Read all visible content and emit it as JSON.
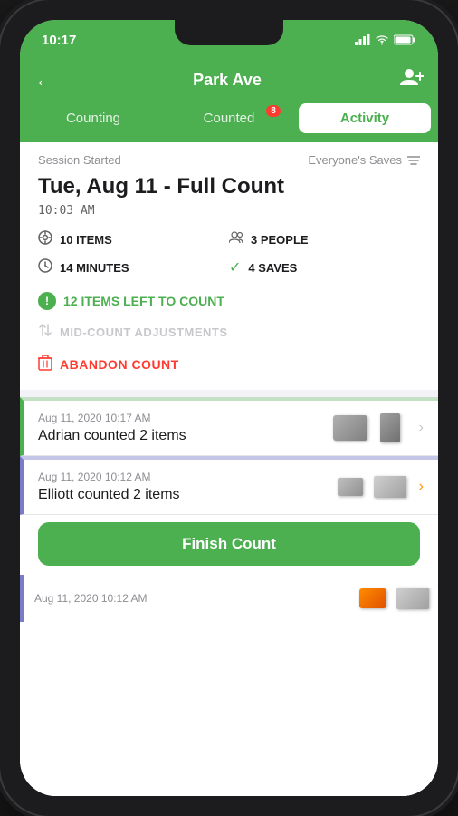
{
  "device": {
    "time": "10:17"
  },
  "header": {
    "back_label": "←",
    "title": "Park Ave",
    "add_user_icon": "👥"
  },
  "tabs": [
    {
      "id": "counting",
      "label": "Counting",
      "active": false,
      "badge": null
    },
    {
      "id": "counted",
      "label": "Counted",
      "active": false,
      "badge": "8"
    },
    {
      "id": "activity",
      "label": "Activity",
      "active": true,
      "badge": null
    }
  ],
  "session": {
    "started_label": "Session Started",
    "filter_label": "Everyone's Saves",
    "filter_icon": "funnel"
  },
  "count_card": {
    "title": "Tue, Aug 11 - Full Count",
    "time": "10:03 AM",
    "stats": [
      {
        "icon": "clock",
        "value": "10 ITEMS",
        "icon_type": "settings"
      },
      {
        "icon": "people",
        "value": "3 PEOPLE",
        "icon_type": "people"
      },
      {
        "icon": "clock",
        "value": "14 MINUTES",
        "icon_type": "clock"
      },
      {
        "icon": "check",
        "value": "4 SAVES",
        "icon_type": "check"
      }
    ],
    "alert": {
      "text": "12 ITEMS LEFT TO COUNT",
      "icon": "!"
    },
    "mid_count_label": "MID-COUNT ADJUSTMENTS",
    "abandon_label": "ABANDON COUNT"
  },
  "activity_items": [
    {
      "date": "Aug 11, 2020 10:17 AM",
      "description": "Adrian counted 2 items",
      "border_color": "#4caf50",
      "chevron_color": "default"
    },
    {
      "date": "Aug 11, 2020 10:12 AM",
      "description": "Elliott counted 2 items",
      "border_color": "#7b7bc8",
      "chevron_color": "orange"
    }
  ],
  "partial_item": {
    "date": "Aug 11, 2020 10:12 AM"
  },
  "footer": {
    "finish_btn_label": "Finish Count"
  }
}
